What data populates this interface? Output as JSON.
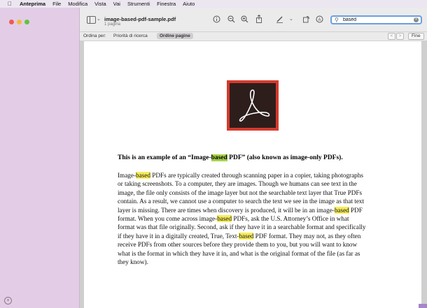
{
  "menubar": {
    "app_name": "Anteprima",
    "items": [
      "File",
      "Modifica",
      "Vista",
      "Vai",
      "Strumenti",
      "Finestra",
      "Aiuto"
    ]
  },
  "document": {
    "title": "image-based-pdf-sample.pdf",
    "pages": "1 pagina"
  },
  "search": {
    "value": "based"
  },
  "findbar": {
    "sort_label": "Ordina per:",
    "options": [
      "Priorità di ricerca",
      "Ordine pagine"
    ],
    "selected": "Ordine pagine",
    "prev": "<",
    "next": ">",
    "done_label": "Fine"
  },
  "page": {
    "heading": [
      "This is an example of an “Image-",
      "based",
      " PDF” (also known as image-only PDFs)."
    ],
    "lines": [
      [
        "Image-",
        "based",
        " PDFs are typically created through scanning paper in a copier, taking photographs"
      ],
      [
        "or taking screenshots. To a computer, they are images. Though we humans can see text in the"
      ],
      [
        "image, the file only consists of the image layer but not the searchable text layer that True PDFs"
      ],
      [
        "contain. As a result, we cannot use a computer to search the text we see in the image as that text"
      ],
      [
        "layer is missing. There are times when discovery is produced, it will be in an image-",
        "based",
        " PDF"
      ],
      [
        "format. When you come across image-",
        "based",
        " PDFs, ask the U.S. Attorney’s Office in what"
      ],
      [
        "format was that file originally. Second, ask if they have it in a searchable format and specifically"
      ],
      [
        "if they have it in a digitally created, True, Text-",
        "based",
        " PDF format. They may not, as they often"
      ],
      [
        "receive PDFs from other sources before they provide them to you, but you will want to know"
      ],
      [
        "what is the format in which they have it in, and what is the original format of the file (as far as"
      ],
      [
        "they know)."
      ]
    ]
  },
  "colors": {
    "highlight": "#f7ec5c",
    "current_highlight": "#a6d24b",
    "logo_red": "#d53a2c",
    "logo_dark": "#2d1e1c",
    "sidebar_bg": "#e3cde6"
  }
}
